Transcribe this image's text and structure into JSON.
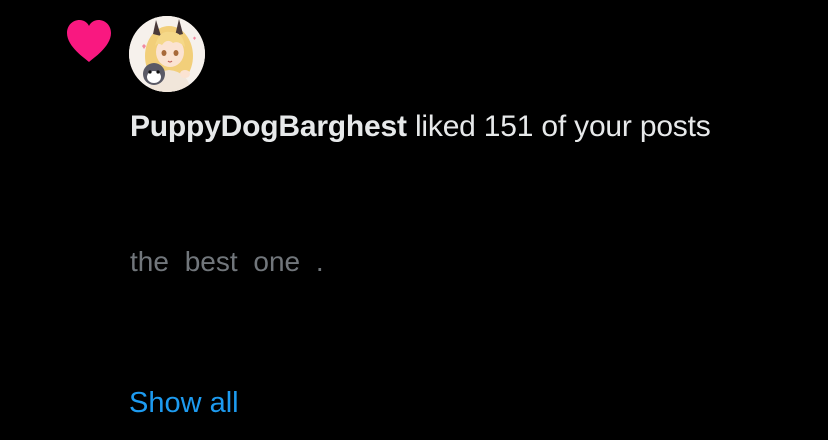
{
  "notification": {
    "type_icon": "heart-icon",
    "accent_color": "#f91880",
    "username": "PuppyDogBarghest",
    "action_text": " liked 151 of your posts",
    "post_snippet": "the best one .",
    "show_all_label": "Show all",
    "link_color": "#1d9bf0"
  }
}
